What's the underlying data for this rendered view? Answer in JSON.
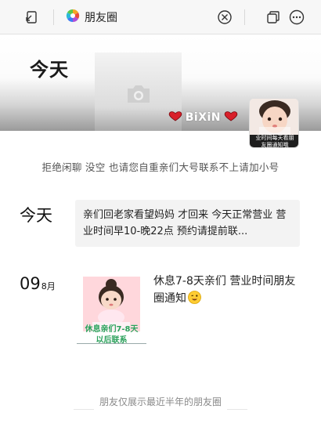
{
  "titlebar": {
    "title": "朋友圈",
    "icons": [
      "back-icon",
      "photo-wheel-icon",
      "close-circle-icon",
      "window-restore-icon",
      "more-icon"
    ]
  },
  "cover": {
    "today_label": "今天",
    "nickname": "BiXiN",
    "avatar_caption_1": "业时间每天看朋",
    "avatar_caption_2": "友圈通知哦"
  },
  "signature": "拒绝闲聊 没空 也请您自重亲们大号联系不上请加小号",
  "posts": [
    {
      "date_label": "今天",
      "text": "亲们回老家看望妈妈 才回来 今天正常营业 营业时间早10-晚22点 预约请提前联..."
    },
    {
      "day": "09",
      "month": "8月",
      "text": "休息7-8天亲们 营业时间朋友圈通知",
      "image_caption_1": "休息亲们7-8天",
      "image_caption_2": "以后联系"
    }
  ],
  "footer_text": "朋友仅展示最近半年的朋友圈",
  "colors": {
    "titlebar_bg": "#f7f7f7",
    "card_bg": "#f3f3f3",
    "caption_green": "#2aa05a",
    "heart_red": "#d8202a"
  }
}
